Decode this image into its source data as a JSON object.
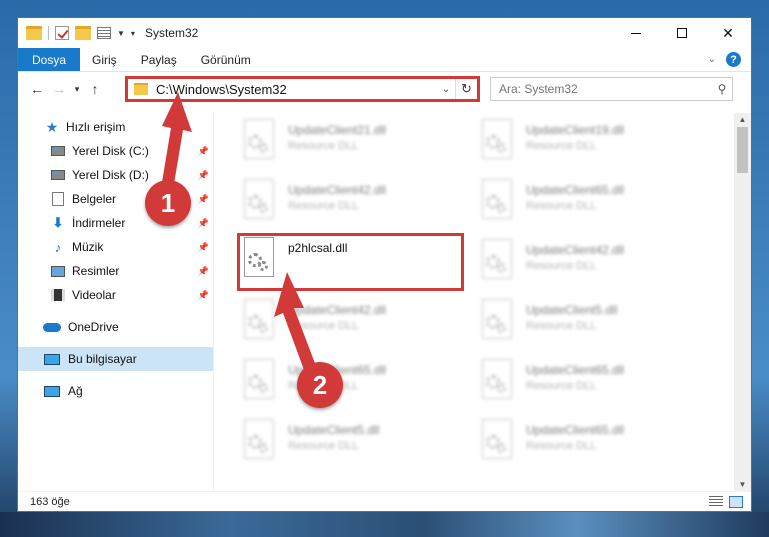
{
  "window": {
    "title": "System32",
    "controls": {
      "minimize": "minimize",
      "maximize": "maximize",
      "close": "✕"
    }
  },
  "ribbon": {
    "tabs": [
      {
        "label": "Dosya",
        "active": true
      },
      {
        "label": "Giriş",
        "active": false
      },
      {
        "label": "Paylaş",
        "active": false
      },
      {
        "label": "Görünüm",
        "active": false
      }
    ],
    "help": "?"
  },
  "nav": {
    "address": "C:\\Windows\\System32",
    "search_placeholder": "Ara: System32"
  },
  "sidebar": {
    "items": [
      {
        "label": "Hızlı erişim",
        "icon": "star-icon"
      },
      {
        "label": "Yerel Disk (C:)",
        "icon": "disk-icon",
        "pinned": true
      },
      {
        "label": "Yerel Disk (D:)",
        "icon": "disk-icon",
        "pinned": true
      },
      {
        "label": "Belgeler",
        "icon": "document-icon",
        "pinned": true
      },
      {
        "label": "İndirmeler",
        "icon": "download-icon",
        "pinned": true
      },
      {
        "label": "Müzik",
        "icon": "music-icon",
        "pinned": true
      },
      {
        "label": "Resimler",
        "icon": "pictures-icon",
        "pinned": true
      },
      {
        "label": "Videolar",
        "icon": "videos-icon",
        "pinned": true
      },
      {
        "label": "OneDrive",
        "icon": "cloud-icon"
      },
      {
        "label": "Bu bilgisayar",
        "icon": "computer-icon",
        "selected": true
      },
      {
        "label": "Ağ",
        "icon": "network-icon"
      }
    ]
  },
  "files": [
    {
      "name": "UpdateClient21.dll",
      "type": "Resource DLL",
      "blurred": true
    },
    {
      "name": "UpdateClient19.dll",
      "type": "Resource DLL",
      "blurred": true
    },
    {
      "name": "UpdateClient42.dll",
      "type": "Resource DLL",
      "blurred": true
    },
    {
      "name": "UpdateClient65.dll",
      "type": "Resource DLL",
      "blurred": true
    },
    {
      "name": "p2hlcsal.dll",
      "type": "",
      "blurred": false
    },
    {
      "name": "UpdateClient42.dll",
      "type": "Resource DLL",
      "blurred": true
    },
    {
      "name": "UpdateClient42.dll",
      "type": "Resource DLL",
      "blurred": true
    },
    {
      "name": "UpdateClient5.dll",
      "type": "Resource DLL",
      "blurred": true
    },
    {
      "name": "UpdateClient65.dll",
      "type": "Resource DLL",
      "blurred": true
    },
    {
      "name": "UpdateClient65.dll",
      "type": "Resource DLL",
      "blurred": true
    },
    {
      "name": "UpdateClient5.dll",
      "type": "Resource DLL",
      "blurred": true
    },
    {
      "name": "UpdateClient65.dll",
      "type": "Resource DLL",
      "blurred": true
    }
  ],
  "status": {
    "count": "163 öğe"
  },
  "annotations": {
    "badge1": "1",
    "badge2": "2",
    "highlight_color": "#d23a3a"
  },
  "colors": {
    "accent": "#1979ca",
    "selected": "#cce4f7"
  }
}
